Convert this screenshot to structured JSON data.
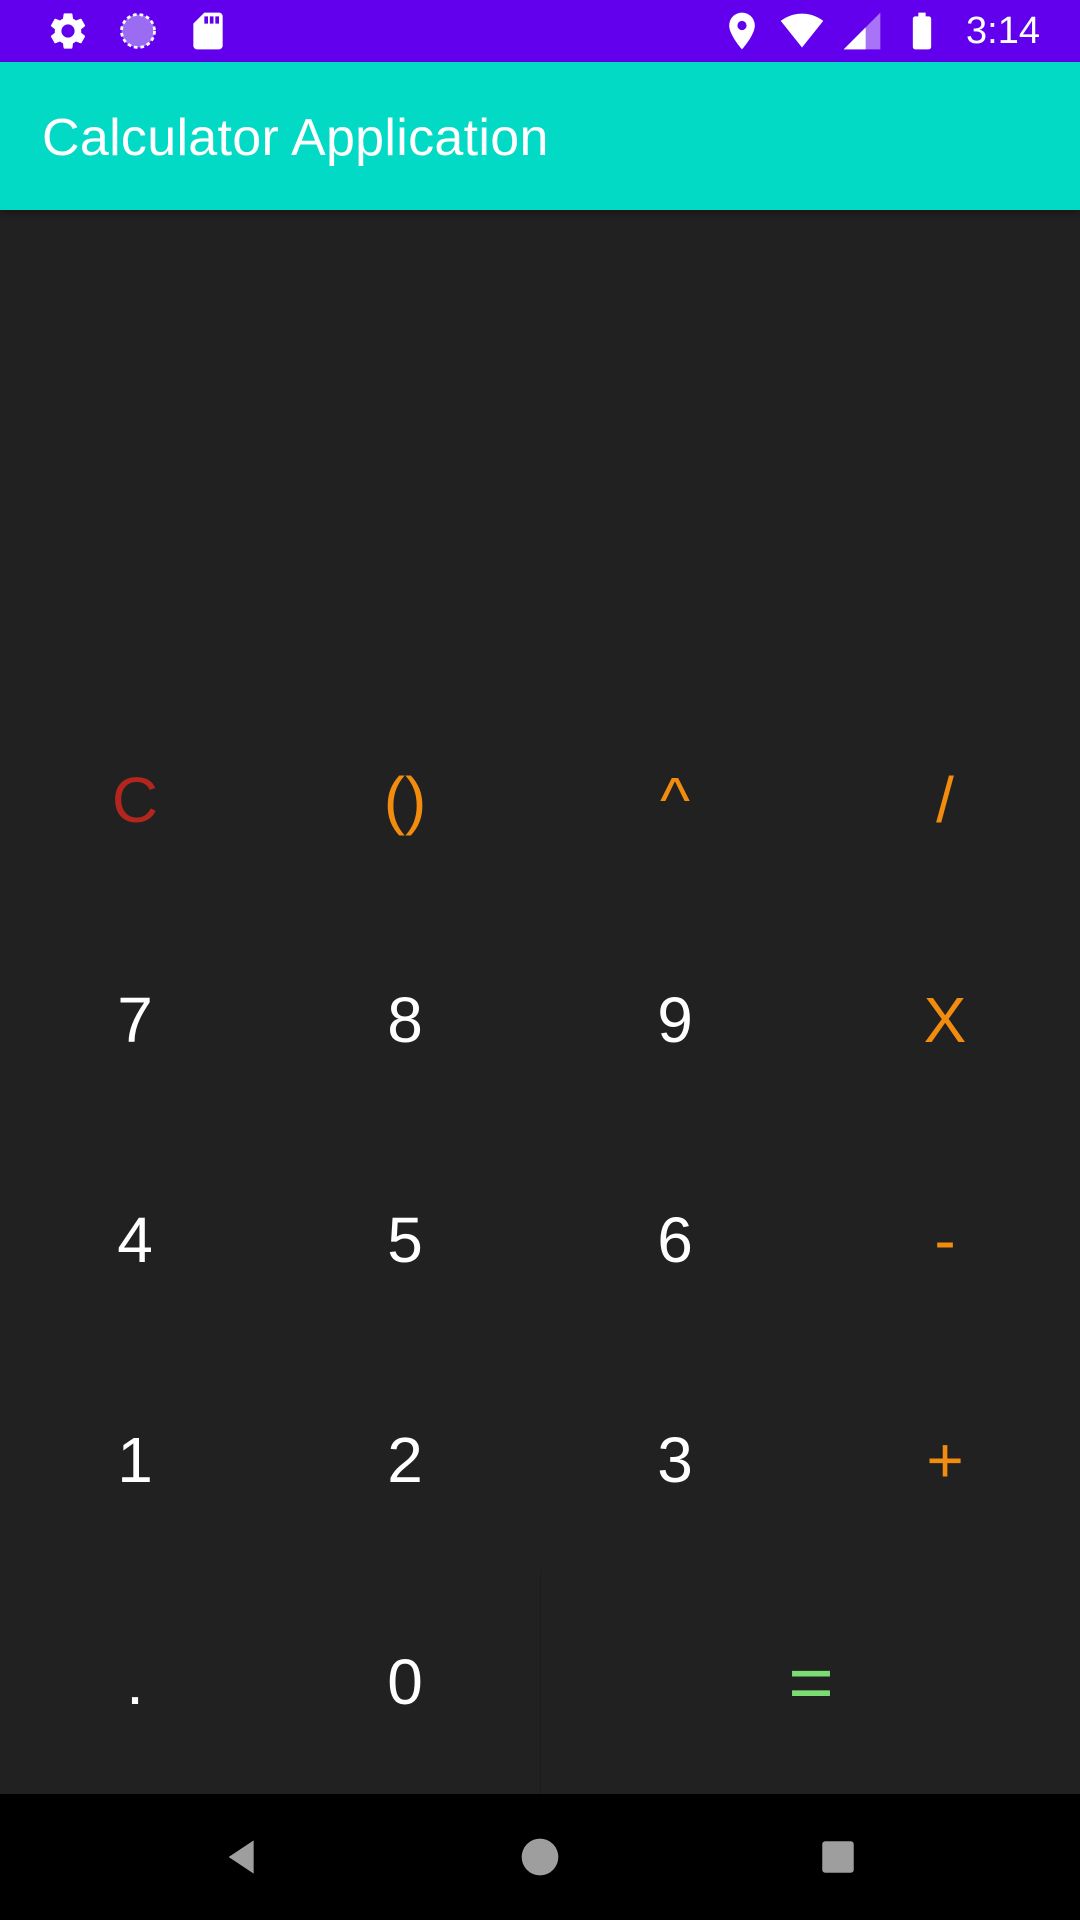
{
  "status_bar": {
    "time": "3:14",
    "left_icons": [
      "settings-icon",
      "sync-icon",
      "sd-card-icon"
    ],
    "right_icons": [
      "location-icon",
      "wifi-icon",
      "signal-icon",
      "battery-icon"
    ]
  },
  "app_bar": {
    "title": "Calculator Application",
    "background": "#03DAC5"
  },
  "display": {
    "expression": "",
    "result": ""
  },
  "keypad": {
    "rows": [
      [
        {
          "label": "C",
          "name": "clear-button",
          "color": "#B3261E"
        },
        {
          "label": "()",
          "name": "parentheses-button",
          "color": "#F28C0F"
        },
        {
          "label": "^",
          "name": "power-button",
          "color": "#F28C0F"
        },
        {
          "label": "/",
          "name": "divide-button",
          "color": "#F28C0F"
        }
      ],
      [
        {
          "label": "7",
          "name": "digit-7-button"
        },
        {
          "label": "8",
          "name": "digit-8-button"
        },
        {
          "label": "9",
          "name": "digit-9-button"
        },
        {
          "label": "X",
          "name": "multiply-button",
          "color": "#F28C0F"
        }
      ],
      [
        {
          "label": "4",
          "name": "digit-4-button"
        },
        {
          "label": "5",
          "name": "digit-5-button"
        },
        {
          "label": "6",
          "name": "digit-6-button"
        },
        {
          "label": "-",
          "name": "subtract-button",
          "color": "#F28C0F"
        }
      ],
      [
        {
          "label": "1",
          "name": "digit-1-button"
        },
        {
          "label": "2",
          "name": "digit-2-button"
        },
        {
          "label": "3",
          "name": "digit-3-button"
        },
        {
          "label": "+",
          "name": "add-button",
          "color": "#F28C0F"
        }
      ],
      [
        {
          "label": ".",
          "name": "decimal-button"
        },
        {
          "label": "0",
          "name": "digit-0-button"
        },
        {
          "label": "=",
          "name": "equals-button",
          "color": "#7CDC74"
        }
      ]
    ]
  },
  "nav_bar": {
    "buttons": [
      "back-icon",
      "home-icon",
      "recents-icon"
    ]
  }
}
